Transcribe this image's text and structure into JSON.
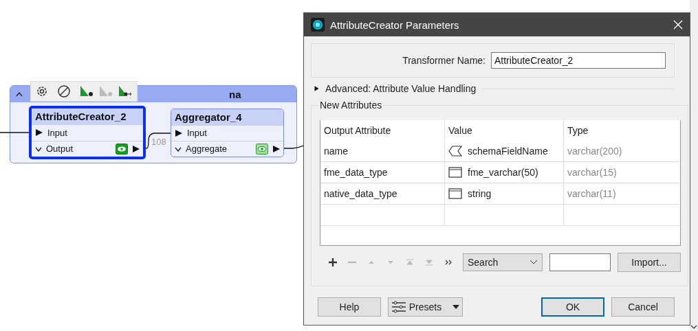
{
  "canvas": {
    "bookmark": {
      "title": "na",
      "expanded": true
    },
    "node_toolbar": [
      {
        "kind": "gear",
        "disabled": false
      },
      {
        "kind": "disable",
        "disabled": false
      },
      {
        "kind": "run",
        "disabled": false
      },
      {
        "kind": "run",
        "disabled": true
      },
      {
        "kind": "run-from",
        "disabled": false
      }
    ],
    "nodes": [
      {
        "title": "AttributeCreator_2",
        "selected": true,
        "input": "Input",
        "output": "Output",
        "cached": true
      },
      {
        "title": "Aggregator_4",
        "selected": false,
        "input": "Input",
        "output": "Aggregate",
        "cached": false
      }
    ],
    "link_count": "108"
  },
  "dialog": {
    "title": "AttributeCreator Parameters",
    "transformer_name": {
      "label": "Transformer Name:",
      "value": "AttributeCreator_2"
    },
    "advanced": {
      "label": "Advanced: Attribute Value Handling",
      "expanded": false
    },
    "group": {
      "label": "New Attributes",
      "columns": [
        "Output Attribute",
        "Value",
        "Type"
      ],
      "rows": [
        {
          "output_attribute": "name",
          "kind": "attribute",
          "value": "schemaFieldName",
          "type": "varchar(200)"
        },
        {
          "output_attribute": "fme_data_type",
          "kind": "constant",
          "value": "fme_varchar(50)",
          "type": "varchar(15)"
        },
        {
          "output_attribute": "native_data_type",
          "kind": "constant",
          "value": "string",
          "type": "varchar(11)"
        }
      ],
      "tools": [
        {
          "kind": "add",
          "disabled": false
        },
        {
          "kind": "remove",
          "disabled": true
        },
        {
          "kind": "up",
          "disabled": true
        },
        {
          "kind": "down",
          "disabled": true
        },
        {
          "kind": "top",
          "disabled": true
        },
        {
          "kind": "bottom",
          "disabled": true
        },
        {
          "kind": "more",
          "disabled": false
        }
      ],
      "search": {
        "value": "Search"
      },
      "import_button": "Import..."
    },
    "buttons": {
      "help": "Help",
      "presets": "Presets",
      "ok": "OK",
      "cancel": "Cancel"
    }
  }
}
